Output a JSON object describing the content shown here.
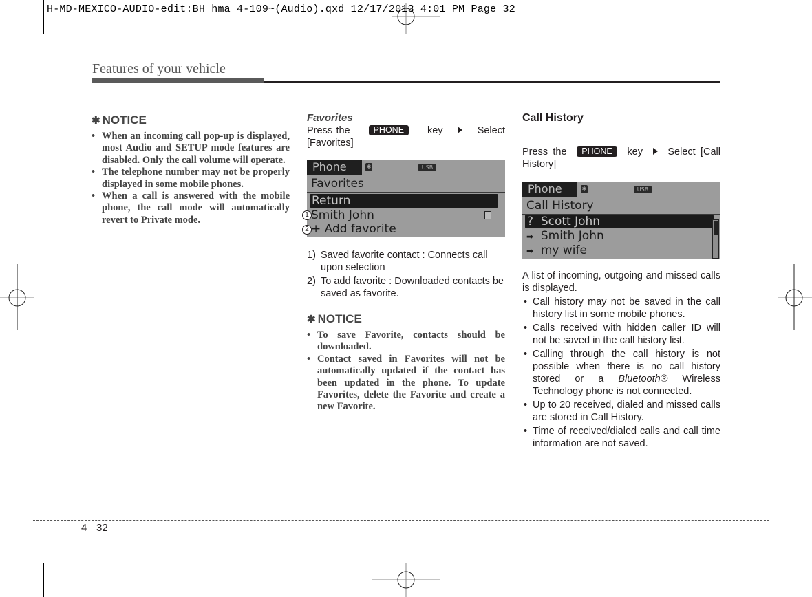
{
  "slug": "H-MD-MEXICO-AUDIO-edit:BH hma 4-109~(Audio).qxd  12/17/2013  4:01 PM  Page 32",
  "header": {
    "title": "Features of your vehicle"
  },
  "col1": {
    "notice_title": "NOTICE",
    "notice_icon": "asterisk-icon",
    "items": [
      "When an incoming call pop-up is displayed, most Audio and SETUP mode features are disabled. Only the call volume will operate.",
      "The telephone number may not be properly displayed in some mobile phones.",
      "When a call is answered with the mobile phone, the call mode will automatically revert to Private mode."
    ]
  },
  "favorites": {
    "heading": "Favorites",
    "instr_pre": "Press the",
    "key_label": "PHONE",
    "instr_mid": "key",
    "instr_post": "Select [Favorites]",
    "screen": {
      "mode": "Phone",
      "bt_icon": "bluetooth-icon",
      "usb_label": "USB",
      "title": "Favorites",
      "rows": [
        "Return",
        "Smith John",
        "+ Add favorite"
      ],
      "callouts": [
        "1",
        "2"
      ]
    },
    "notes": [
      {
        "n": "1)",
        "text": "Saved favorite contact : Connects call upon selection"
      },
      {
        "n": "2)",
        "text": "To add favorite : Downloaded contacts be saved as favorite."
      }
    ],
    "notice_title": "NOTICE",
    "notice_items": [
      "To save Favorite, contacts should be downloaded.",
      "Contact saved in Favorites will not be automatically updated if the contact has been updated in the phone. To update Favorites, delete the Favorite and create a new Favorite."
    ]
  },
  "call_history": {
    "heading": "Call History",
    "instr_pre": "Press the",
    "key_label": "PHONE",
    "instr_mid": "key",
    "instr_post": "Select [Call History]",
    "screen": {
      "mode": "Phone",
      "usb_label": "USB",
      "title": "Call History",
      "rows": [
        {
          "icon": "?",
          "name": "Scott John"
        },
        {
          "icon": "➡",
          "name": "Smith John"
        },
        {
          "icon": "➡",
          "name": "my wife"
        }
      ]
    },
    "intro": "A list of incoming, outgoing and missed calls is displayed.",
    "bullets": [
      "Call history may not be saved in the call history list in some mobile phones.",
      "Calls received with hidden caller ID will not be saved in the call history list.",
      "Calling through the call history is not possible when there is no call history stored or a",
      "Up to 20 received, dialed and missed calls are stored in Call History.",
      "Time of received/dialed calls and call time information are not saved."
    ],
    "bt_brand": "Bluetooth®",
    "bt_tail": "Wireless Technology phone is not connected."
  },
  "footer": {
    "section": "4",
    "page": "32"
  }
}
